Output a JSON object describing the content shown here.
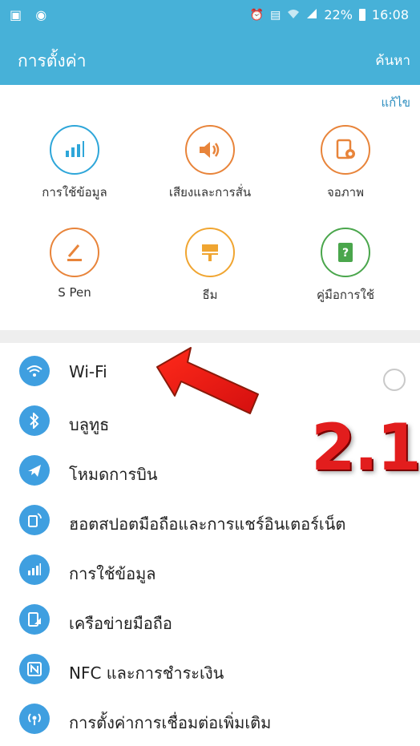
{
  "status_bar": {
    "battery": "22%",
    "time": "16:08"
  },
  "app_bar": {
    "title": "การตั้งค่า",
    "search_label": "ค้นหา"
  },
  "quick_settings": {
    "edit_label": "แก้ไข",
    "items": [
      {
        "label": "การใช้ข้อมูล",
        "icon": "data-usage-icon",
        "color": "#2ea6d9"
      },
      {
        "label": "เสียงและการสั่น",
        "icon": "sound-icon",
        "color": "#e8843a"
      },
      {
        "label": "จอภาพ",
        "icon": "display-icon",
        "color": "#e8843a"
      },
      {
        "label": "S Pen",
        "icon": "spen-icon",
        "color": "#e8843a"
      },
      {
        "label": "ธีม",
        "icon": "theme-icon",
        "color": "#f0a531"
      },
      {
        "label": "คู่มือการใช้",
        "icon": "manual-icon",
        "color": "#4aa64c"
      }
    ]
  },
  "connections": {
    "items": [
      {
        "label": "Wi-Fi",
        "icon": "wifi-icon"
      },
      {
        "label": "บลูทูธ",
        "icon": "bluetooth-icon"
      },
      {
        "label": "โหมดการบิน",
        "icon": "airplane-icon"
      },
      {
        "label": "ฮอตสปอตมือถือและการแชร์อินเตอร์เน็ต",
        "icon": "hotspot-icon"
      },
      {
        "label": "การใช้ข้อมูล",
        "icon": "data-usage-icon"
      },
      {
        "label": "เครือข่ายมือถือ",
        "icon": "mobile-network-icon"
      },
      {
        "label": "NFC และการชำระเงิน",
        "icon": "nfc-icon"
      },
      {
        "label": "การตั้งค่าการเชื่อมต่อเพิ่มเติม",
        "icon": "more-connections-icon"
      }
    ],
    "wifi_toggle_state": "off"
  },
  "annotation": {
    "step_label": "2.1",
    "color": "#e21d1d"
  }
}
